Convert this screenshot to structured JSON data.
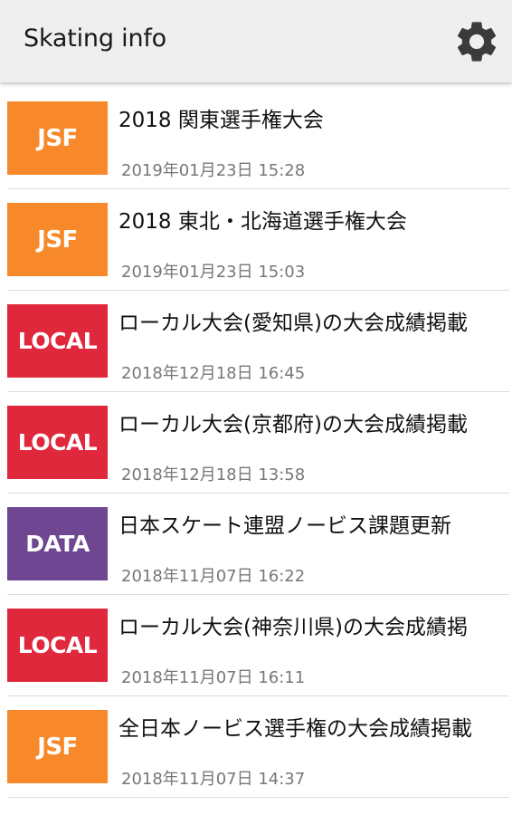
{
  "app_bar": {
    "title": "Skating info",
    "settings_icon": "gear-icon"
  },
  "colors": {
    "JSF": "#f7892a",
    "LOCAL": "#e0283d",
    "DATA": "#6e4691",
    "app_bar_bg": "#efefef"
  },
  "items": [
    {
      "badge": "JSF",
      "title": "2018 関東選手権大会",
      "date": "2019年01月23日 15:28"
    },
    {
      "badge": "JSF",
      "title": "2018 東北・北海道選手権大会",
      "date": "2019年01月23日 15:03"
    },
    {
      "badge": "LOCAL",
      "title": "ローカル大会(愛知県)の大会成績掲載",
      "date": "2018年12月18日 16:45"
    },
    {
      "badge": "LOCAL",
      "title": "ローカル大会(京都府)の大会成績掲載",
      "date": "2018年12月18日 13:58"
    },
    {
      "badge": "DATA",
      "title": "日本スケート連盟ノービス課題更新",
      "date": "2018年11月07日 16:22"
    },
    {
      "badge": "LOCAL",
      "title": "ローカル大会(神奈川県)の大会成績掲",
      "date": "2018年11月07日 16:11"
    },
    {
      "badge": "JSF",
      "title": "全日本ノービス選手権の大会成績掲載",
      "date": "2018年11月07日 14:37"
    }
  ]
}
